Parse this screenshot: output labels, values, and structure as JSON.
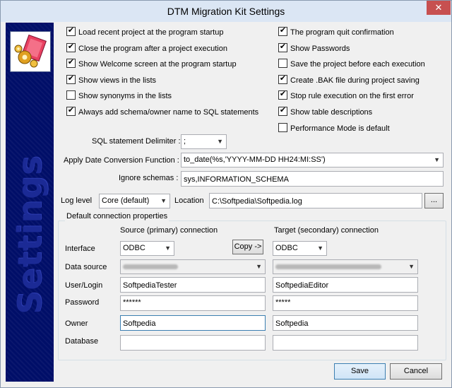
{
  "window": {
    "title": "DTM Migration Kit Settings",
    "close_symbol": "✕"
  },
  "sidebar": {
    "text": "Settings",
    "logo_icon": "migration-kit-logo"
  },
  "checkboxes_left": [
    {
      "label": "Load recent project at the program startup",
      "checked": true
    },
    {
      "label": "Close the program after a project execution",
      "checked": true
    },
    {
      "label": "Show Welcome screen at the program startup",
      "checked": true
    },
    {
      "label": "Show views in the lists",
      "checked": true
    },
    {
      "label": "Show synonyms in the lists",
      "checked": false
    },
    {
      "label": "Always add schema/owner name to SQL statements",
      "checked": true
    }
  ],
  "checkboxes_right": [
    {
      "label": "The program quit confirmation",
      "checked": true
    },
    {
      "label": "Show Passwords",
      "checked": true
    },
    {
      "label": "Save the project before each execution",
      "checked": false
    },
    {
      "label": "Create .BAK file during project saving",
      "checked": true
    },
    {
      "label": "Stop rule execution on the first error",
      "checked": true
    },
    {
      "label": "Show table descriptions",
      "checked": true
    },
    {
      "label": "Performance Mode is default",
      "checked": false
    }
  ],
  "sql_delimiter": {
    "label": "SQL statement Delimiter :",
    "value": ";"
  },
  "date_conversion": {
    "label": "Apply Date Conversion Function :",
    "value": "to_date(%s,'YYYY-MM-DD HH24:MI:SS')"
  },
  "ignore_schemas": {
    "label": "Ignore schemas :",
    "value": "sys,INFORMATION_SCHEMA"
  },
  "log": {
    "level_label": "Log level",
    "level_value": "Core (default)",
    "location_label": "Location",
    "location_value": "C:\\Softpedia\\Softpedia.log",
    "browse_label": "..."
  },
  "connection": {
    "group_title": "Default connection properties",
    "source_header": "Source (primary) connection",
    "target_header": "Target (secondary) connection",
    "copy_label": "Copy ->",
    "labels": {
      "interface": "Interface",
      "data_source": "Data source",
      "user": "User/Login",
      "password": "Password",
      "owner": "Owner",
      "database": "Database"
    },
    "source": {
      "interface": "ODBC",
      "user": "SoftpediaTester",
      "password": "******",
      "owner": "Softpedia",
      "database": ""
    },
    "target": {
      "interface": "ODBC",
      "user": "SoftpediaEditor",
      "password": "*****",
      "owner": "Softpedia",
      "database": ""
    }
  },
  "buttons": {
    "save": "Save",
    "cancel": "Cancel"
  }
}
